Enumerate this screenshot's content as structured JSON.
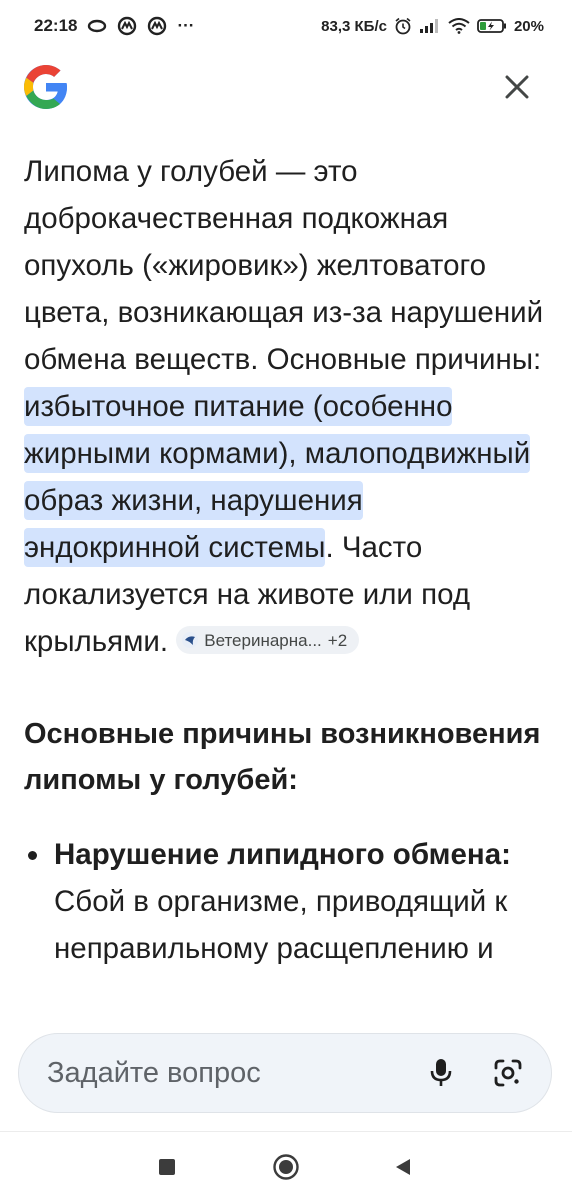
{
  "status_bar": {
    "time": "22:18",
    "more": "···",
    "speed": "83,3 КБ/с",
    "battery_percent": "20%"
  },
  "header": {
    "logo_icon": "google-g-icon",
    "close_icon": "close-icon"
  },
  "answer": {
    "intro_plain": "Липома у голубей — это доброкачественная подкожная опухоль («жировик») желтоватого цвета, возникающая из-за нарушений обмена веществ. Основные причины: ",
    "intro_highlight": "избыточное питание (особенно жирными кормами), малоподвижный образ жизни, нарушения эндокринной системы",
    "intro_tail": ". Часто локализуется на животе или под крыльями.",
    "source_chip": {
      "label": "Ветеринарна...",
      "count": "+2"
    }
  },
  "section": {
    "heading": "Основные причины возникновения липомы у голубей:",
    "bullets": [
      {
        "title": "Нарушение липидного обмена:",
        "text": "Сбой в организме, приводящий к неправильному расщеплению и"
      }
    ]
  },
  "ask_bar": {
    "placeholder": "Задайте вопрос"
  },
  "colors": {
    "highlight": "#d3e3fd",
    "text": "#1f1f1f",
    "ask_bar_bg": "#f0f4f9"
  }
}
